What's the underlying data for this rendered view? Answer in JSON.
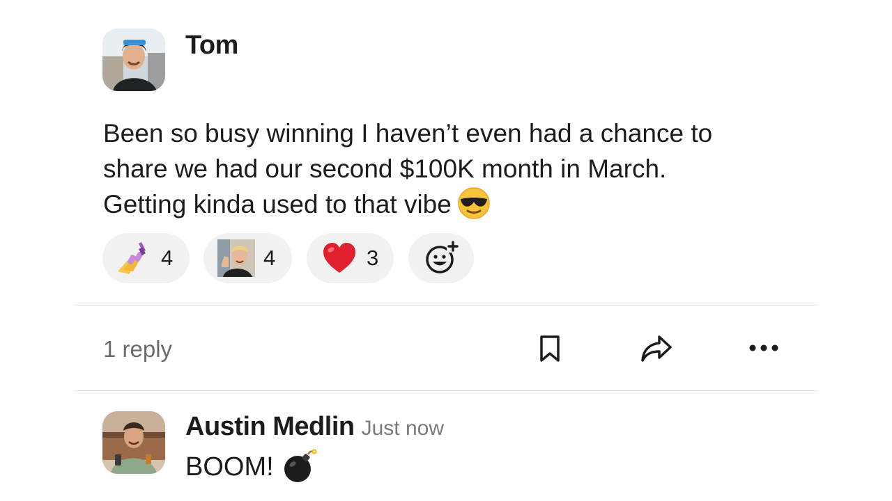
{
  "post": {
    "author": "Tom",
    "message_lines": [
      "Been so busy winning I haven’t even had a chance to",
      "share we had our second $100K month in March.",
      "Getting kinda used to that vibe"
    ],
    "inline_emoji": "smiling-face-with-sunglasses",
    "reactions": [
      {
        "emoji": "nail-polish",
        "count": "4"
      },
      {
        "emoji": "custom-photo-thumbs-up",
        "count": "4"
      },
      {
        "emoji": "red-heart",
        "count": "3"
      }
    ],
    "add_reaction_icon": "add-reaction-icon"
  },
  "thread": {
    "reply_count": "1 reply",
    "actions": [
      "bookmark-icon",
      "share-icon",
      "more-icon"
    ]
  },
  "reply": {
    "author": "Austin Medlin",
    "timestamp": "Just now",
    "text": "BOOM!",
    "emoji": "bomb"
  },
  "colors": {
    "reaction_bg": "#f1f1f1",
    "divider": "#dddddd",
    "muted_text": "#6b6b6b",
    "heart": "#e0202e"
  }
}
